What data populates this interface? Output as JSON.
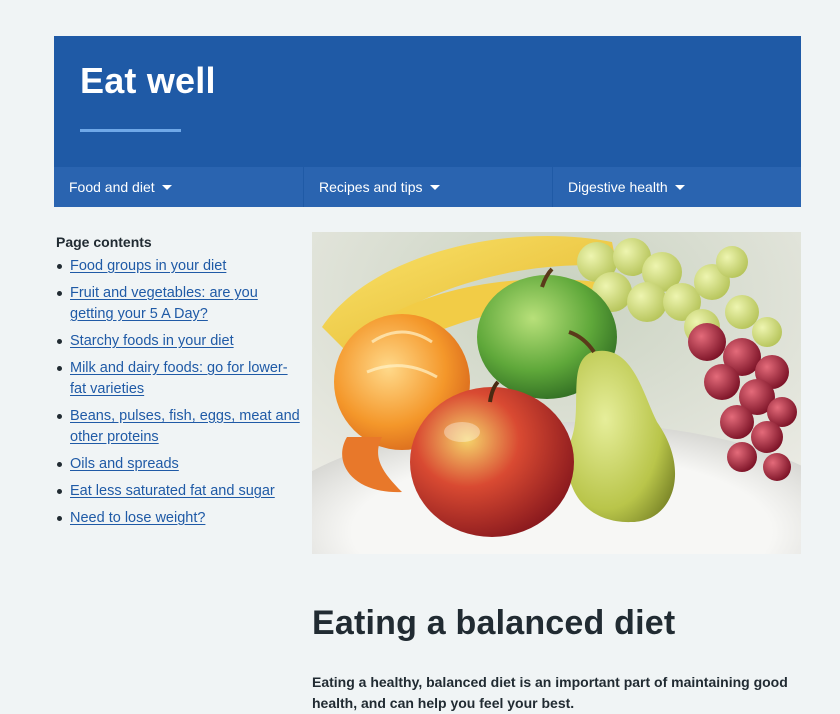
{
  "banner": {
    "title": "Eat well"
  },
  "nav": [
    {
      "label": "Food and diet"
    },
    {
      "label": "Recipes and tips"
    },
    {
      "label": "Digestive health"
    }
  ],
  "contents": {
    "heading": "Page contents",
    "items": [
      {
        "label": "Food groups in your diet"
      },
      {
        "label": "Fruit and vegetables: are you getting your 5 A Day?"
      },
      {
        "label": "Starchy foods in your diet"
      },
      {
        "label": "Milk and dairy foods: go for lower-fat varieties"
      },
      {
        "label": "Beans, pulses, fish, eggs, meat and other proteins"
      },
      {
        "label": "Oils and spreads"
      },
      {
        "label": "Eat less saturated fat and sugar"
      },
      {
        "label": "Need to lose weight?"
      }
    ]
  },
  "main": {
    "heading": "Eating a balanced diet",
    "intro": "Eating a healthy, balanced diet is an important part of maintaining good health, and can help you feel your best."
  },
  "colors": {
    "banner": "#1f5aa6",
    "nav": "#2a64b0",
    "link": "#1f5aa6",
    "page_background": "#f0f4f5"
  },
  "icons": {
    "nav_dropdown": "caret-down-icon"
  }
}
